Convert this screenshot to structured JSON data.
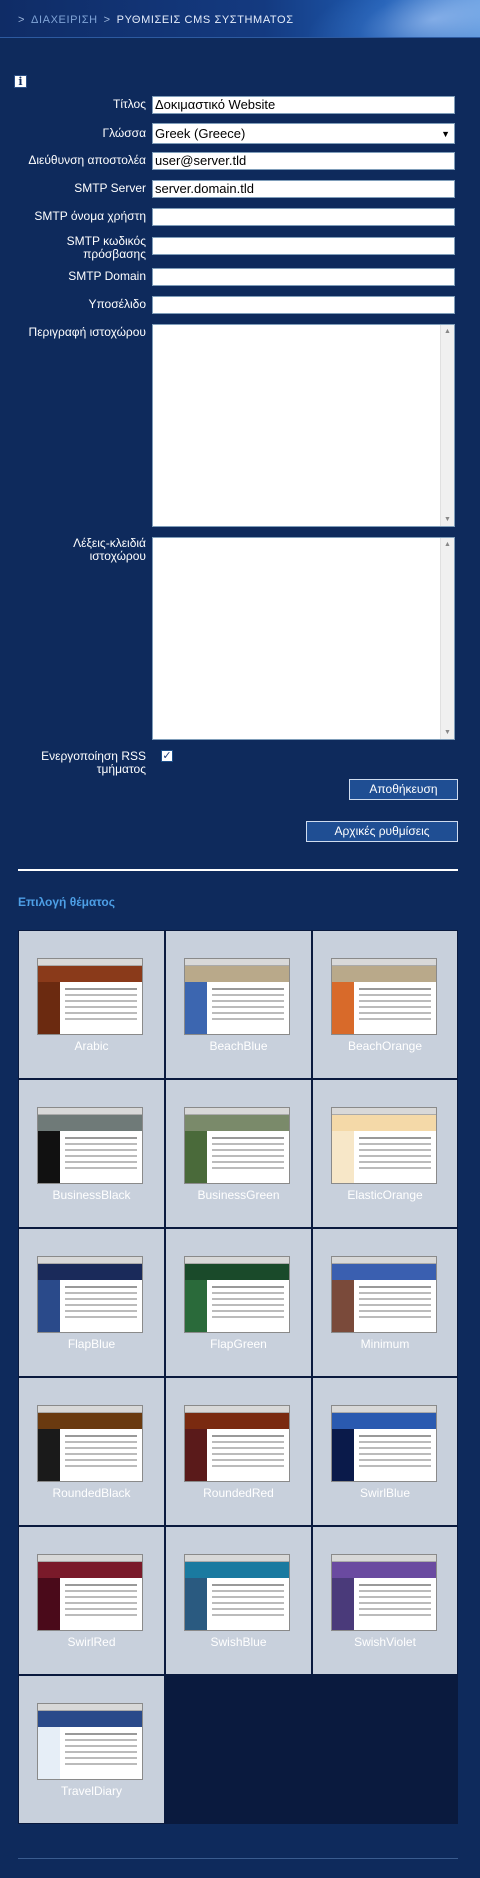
{
  "breadcrumb": {
    "separator": ">",
    "parent": "ΔΙΑΧΕΙΡΙΣΗ",
    "current": "ΡΥΘΜΙΣΕΙΣ CMS ΣΥΣΤΗΜΑΤΟΣ"
  },
  "info_icon": "i",
  "form": {
    "title_label": "Τίτλος",
    "title_value": "Δοκιμαστικό Website",
    "language_label": "Γλώσσα",
    "language_value": "Greek (Greece)",
    "sender_label": "Διεύθυνση αποστολέα",
    "sender_value": "user@server.tld",
    "smtp_server_label": "SMTP Server",
    "smtp_server_value": "server.domain.tld",
    "smtp_user_label": "SMTP όνομα χρήστη",
    "smtp_user_value": "",
    "smtp_password_label_1": "SMTP κωδικός",
    "smtp_password_label_2": "πρόσβασης",
    "smtp_password_value": "",
    "smtp_domain_label": "SMTP Domain",
    "smtp_domain_value": "",
    "footer_label": "Υποσέλιδο",
    "footer_value": "",
    "description_label": "Περιγραφή ιστοχώρου",
    "keywords_label_1": "Λέξεις-κλειδιά",
    "keywords_label_2": "ιστοχώρου",
    "rss_label_1": "Ενεργοποίηση RSS",
    "rss_label_2": "τμήματος",
    "rss_checked": true,
    "save_button": "Αποθήκευση",
    "reset_button": "Αρχικές ρυθμίσεις"
  },
  "theme_section": {
    "title": "Επιλογή θέματος",
    "themes": [
      {
        "name": "Arabic",
        "header": "#8a3a1a",
        "side": "#6b2a10",
        "frame": "#f3e9dc"
      },
      {
        "name": "BeachBlue",
        "header": "#b9a98a",
        "side": "#3c66b0",
        "frame": "#ffffff"
      },
      {
        "name": "BeachOrange",
        "header": "#b9a98a",
        "side": "#d86a2a",
        "frame": "#ffffff"
      },
      {
        "name": "BusinessBlack",
        "header": "#6f7a78",
        "side": "#111111",
        "frame": "#ffffff"
      },
      {
        "name": "BusinessGreen",
        "header": "#7a8a6a",
        "side": "#4a6a3a",
        "frame": "#ffffff"
      },
      {
        "name": "ElasticOrange",
        "header": "#f4d9a8",
        "side": "#f7e7c8",
        "frame": "#ffffff"
      },
      {
        "name": "FlapBlue",
        "header": "#1a2a5a",
        "side": "#2a4a8a",
        "frame": "#e6eef7"
      },
      {
        "name": "FlapGreen",
        "header": "#1a4a2a",
        "side": "#2a6a3a",
        "frame": "#e6f2ea"
      },
      {
        "name": "Minimum",
        "header": "#3a5fb0",
        "side": "#7a4a3a",
        "frame": "#ffffff"
      },
      {
        "name": "RoundedBlack",
        "header": "#6a3a10",
        "side": "#1a1a1a",
        "frame": "#222222"
      },
      {
        "name": "RoundedRed",
        "header": "#7a2a10",
        "side": "#5a1a1a",
        "frame": "#3a0a0a"
      },
      {
        "name": "SwirlBlue",
        "header": "#2a5ab0",
        "side": "#0a1a4a",
        "frame": "#0a1a3a"
      },
      {
        "name": "SwirlRed",
        "header": "#7a1a2a",
        "side": "#4a0a1a",
        "frame": "#3a0a10"
      },
      {
        "name": "SwishBlue",
        "header": "#1a7aa0",
        "side": "#2a5a80",
        "frame": "#0e5a7a"
      },
      {
        "name": "SwishViolet",
        "header": "#6a4aa0",
        "side": "#4a3a7a",
        "frame": "#3a2a5a"
      },
      {
        "name": "TravelDiary",
        "header": "#2a4a8a",
        "side": "#e6eef7",
        "frame": "#1a3a7a"
      }
    ]
  }
}
